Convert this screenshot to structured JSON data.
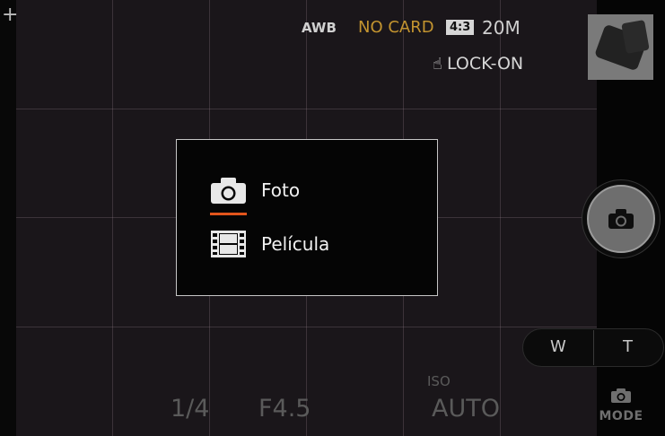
{
  "status": {
    "white_balance": "AWB",
    "storage": "NO CARD",
    "aspect_ratio": "4:3",
    "megapixels": "20M",
    "touch_mode": "LOCK-ON"
  },
  "zoom": {
    "wide": "W",
    "tele": "T"
  },
  "mode_button": {
    "label": "MODE"
  },
  "exposure": {
    "shutter_speed": "1/4",
    "aperture": "F4.5",
    "iso_label": "ISO",
    "iso_value": "AUTO"
  },
  "mode_dialog": {
    "items": [
      {
        "label": "Foto",
        "icon": "camera-icon",
        "selected": true
      },
      {
        "label": "Película",
        "icon": "film-icon",
        "selected": false
      }
    ]
  },
  "colors": {
    "accent_selected": "#e2551c",
    "no_card": "#c3942f"
  }
}
